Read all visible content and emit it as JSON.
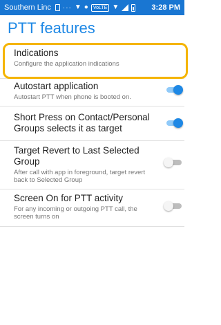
{
  "status_bar": {
    "carrier": "Southern Linc",
    "dots": "···",
    "volte": "VoLTE",
    "time": "3:28 PM"
  },
  "page": {
    "title": "PTT features"
  },
  "items": [
    {
      "title": "Indications",
      "subtitle": "Configure the application indications"
    },
    {
      "title": "Autostart application",
      "subtitle": "Autostart PTT when phone is booted on.",
      "toggle": "on"
    },
    {
      "title": "Short Press on Contact/Personal Groups selects it as target",
      "subtitle": "",
      "toggle": "on"
    },
    {
      "title": "Target Revert to Last Selected Group",
      "subtitle": "After call with app in foreground, target revert back to Selected Group",
      "toggle": "off"
    },
    {
      "title": "Screen On for PTT activity",
      "subtitle": "For any incoming or outgoing PTT call, the screen turns on",
      "toggle": "off"
    }
  ],
  "colors": {
    "accent": "#1e88e5",
    "status_bar": "#1976d2",
    "highlight": "#f5b400"
  }
}
